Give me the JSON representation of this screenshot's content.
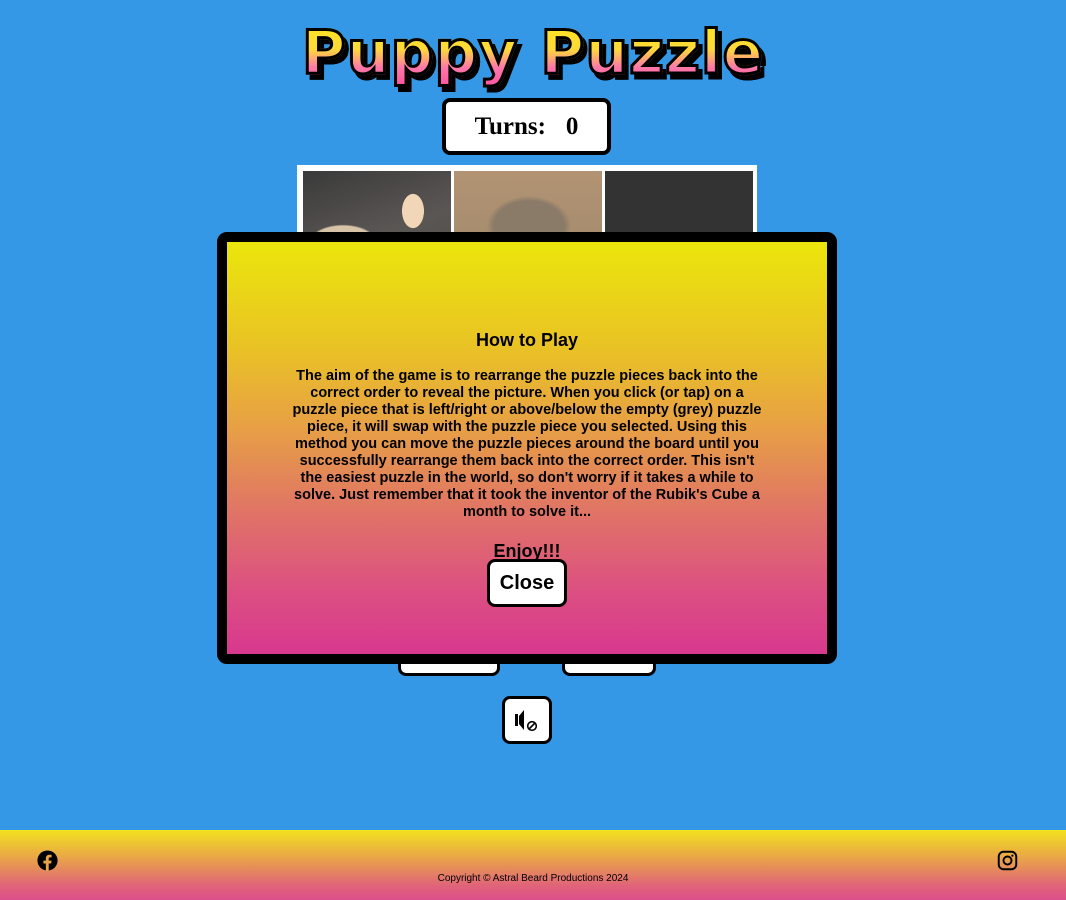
{
  "header": {
    "title": "Puppy Puzzle"
  },
  "turns": {
    "label": "Turns:",
    "value": "0"
  },
  "controls": {
    "left_button_label": "",
    "right_button_label": "",
    "mute_icon": "sound-muted-icon"
  },
  "modal": {
    "heading": "How to Play",
    "body": "The aim of the game is to rearrange the puzzle pieces back into the correct order to reveal the picture. When you click (or tap) on a puzzle piece that is left/right or above/below the empty (grey) puzzle piece, it will swap with the puzzle piece you selected. Using this method you can move the puzzle pieces around the board until you successfully rearrange them back into the correct order. This isn't the easiest puzzle in the world, so don't worry if it takes a while to solve. Just remember that it took the inventor of the Rubik's Cube a month to solve it...",
    "enjoy": "Enjoy!!!",
    "close_label": "Close"
  },
  "footer": {
    "copyright": "Copyright © Astral Beard Productions 2024",
    "social_icons": [
      "facebook-icon",
      "instagram-icon"
    ]
  },
  "colors": {
    "background": "#3498e6",
    "empty_tile": "#333333",
    "modal_top": "#ebe60c",
    "modal_bottom": "#d8388e"
  }
}
